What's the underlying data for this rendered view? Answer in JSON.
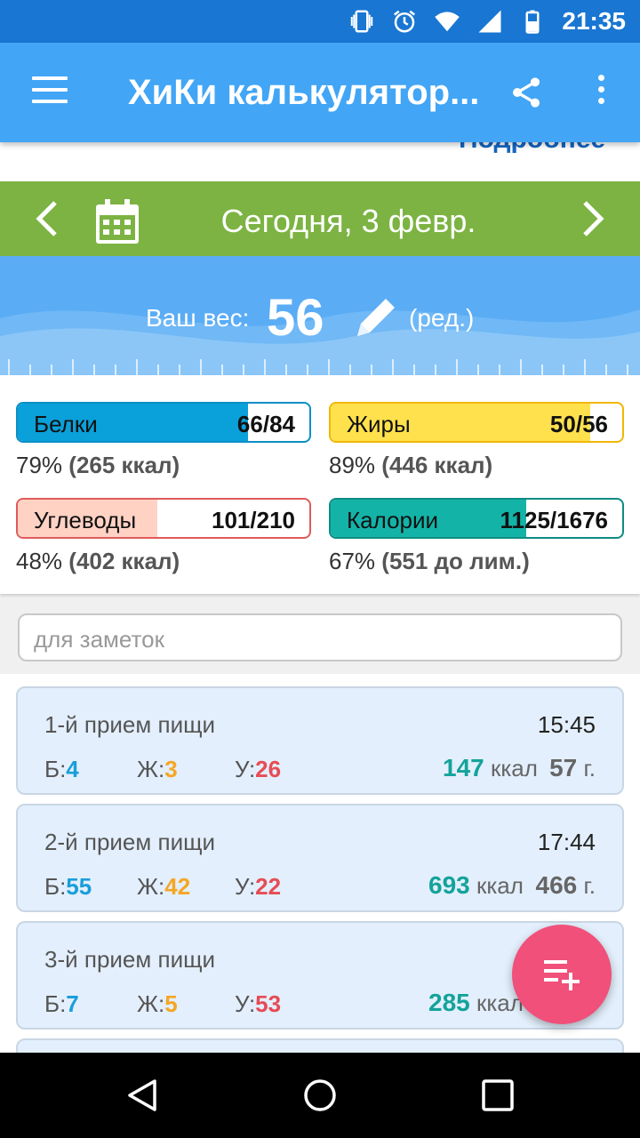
{
  "status_bar": {
    "time": "21:35"
  },
  "app_bar": {
    "title": "ХиКи калькулятор..."
  },
  "link_strip": {
    "text": "Подробнее"
  },
  "date_bar": {
    "date": "Сегодня, 3 февр."
  },
  "weight": {
    "label": "Ваш вес:",
    "value": "56",
    "edit_label": "(ред.)"
  },
  "macros": {
    "protein": {
      "name": "Белки",
      "value": "66/84",
      "detail_pct": "79%",
      "detail_extra": "(265 ккал)",
      "fill_fraction": 0.79,
      "color": "#0aa0d9"
    },
    "fat": {
      "name": "Жиры",
      "value": "50/56",
      "detail_pct": "89%",
      "detail_extra": "(446 ккал)",
      "fill_fraction": 0.89,
      "color": "#ffe14d"
    },
    "carbs": {
      "name": "Углеводы",
      "value": "101/210",
      "detail_pct": "48%",
      "detail_extra": "(402 ккал)",
      "fill_fraction": 0.48,
      "color": "#ffd2c4"
    },
    "calories": {
      "name": "Калории",
      "value": "1125/1676",
      "detail_pct": "67%",
      "detail_extra": "(551 до лим.)",
      "fill_fraction": 0.67,
      "color": "#14b3a8"
    }
  },
  "notes": {
    "placeholder": "для заметок"
  },
  "meals": [
    {
      "name": "1-й прием пищи",
      "time": "15:45",
      "b_label": "Б:",
      "b": "4",
      "j_label": "Ж:",
      "j": "3",
      "u_label": "У:",
      "u": "26",
      "kcal": "147",
      "kcal_unit": "ккал",
      "grams": "57",
      "grams_unit": "г."
    },
    {
      "name": "2-й прием пищи",
      "time": "17:44",
      "b_label": "Б:",
      "b": "55",
      "j_label": "Ж:",
      "j": "42",
      "u_label": "У:",
      "u": "22",
      "kcal": "693",
      "kcal_unit": "ккал",
      "grams": "466",
      "grams_unit": "г."
    },
    {
      "name": "3-й прием пищи",
      "time": "",
      "b_label": "Б:",
      "b": "7",
      "j_label": "Ж:",
      "j": "5",
      "u_label": "У:",
      "u": "53",
      "kcal": "285",
      "kcal_unit": "ккал",
      "grams": "",
      "grams_unit": ""
    }
  ],
  "colors": {
    "status_bar": "#1976d2",
    "app_bar": "#42a5f5",
    "date_bar": "#7cb342",
    "fab": "#f0507a"
  }
}
